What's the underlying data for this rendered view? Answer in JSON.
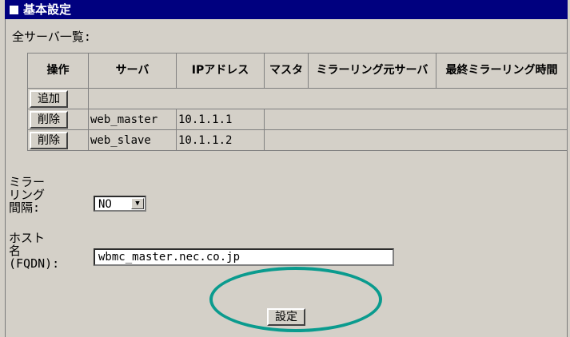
{
  "window": {
    "title": "基本設定"
  },
  "section": {
    "all_servers_label": "全サーバ一覧:"
  },
  "table": {
    "headers": [
      "操作",
      "サーバ",
      "IPアドレス",
      "マスタ",
      "ミラーリング元サーバ",
      "最終ミラーリング時間"
    ],
    "add_button": "追加",
    "rows": [
      {
        "action": "削除",
        "server": "web_master",
        "ip": "10.1.1.1"
      },
      {
        "action": "削除",
        "server": "web_slave",
        "ip": "10.1.1.2"
      }
    ]
  },
  "mirroring_interval": {
    "label": "ミラーリング間隔:",
    "value": "NO"
  },
  "hostname": {
    "label": "ホスト名(FQDN):",
    "value": "wbmc_master.nec.co.jp"
  },
  "submit": {
    "label": "設定"
  },
  "highlight_color": "#0a9b8e"
}
